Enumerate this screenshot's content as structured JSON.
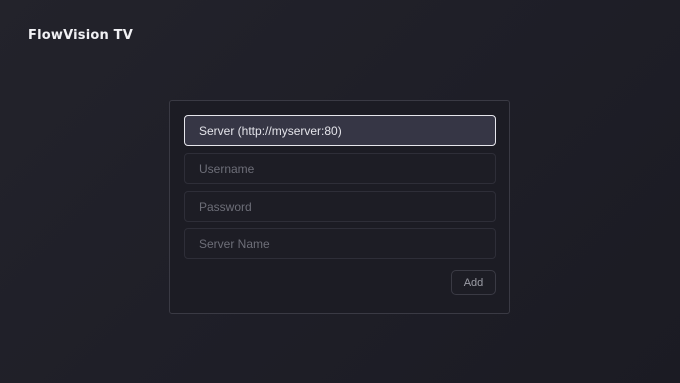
{
  "app": {
    "title": "FlowVision TV"
  },
  "form": {
    "fields": [
      {
        "placeholder": "Server (http://myserver:80)",
        "value": "",
        "focused": true
      },
      {
        "placeholder": "Username",
        "value": ""
      },
      {
        "placeholder": "Password",
        "value": ""
      },
      {
        "placeholder": "Server Name",
        "value": ""
      }
    ],
    "add_label": "Add"
  },
  "colors": {
    "background": "#1f1f28",
    "panel": "#1c1c24",
    "focused_field": "#363645",
    "focus_border": "#e6e6ec"
  }
}
